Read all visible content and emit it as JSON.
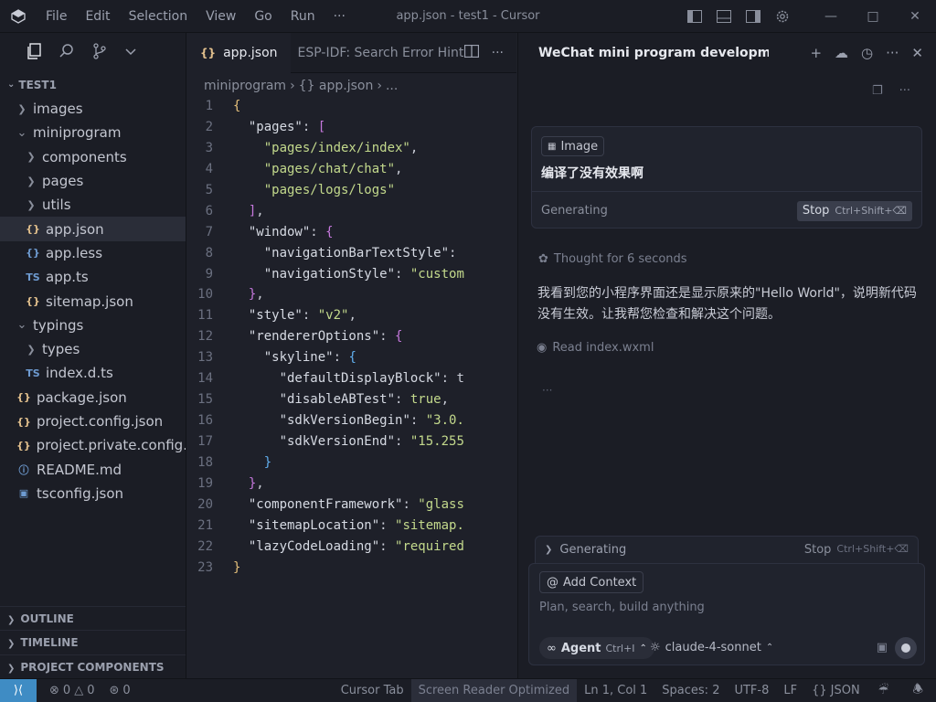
{
  "titlebar": {
    "menu": [
      "File",
      "Edit",
      "Selection",
      "View",
      "Go",
      "Run"
    ],
    "more": "···",
    "title": "app.json - test1 - Cursor"
  },
  "explorer": {
    "root": "TEST1",
    "items": [
      {
        "label": "images",
        "type": "folder",
        "open": false,
        "depth": 1
      },
      {
        "label": "miniprogram",
        "type": "folder",
        "open": true,
        "depth": 1
      },
      {
        "label": "components",
        "type": "folder",
        "open": false,
        "depth": 2
      },
      {
        "label": "pages",
        "type": "folder",
        "open": false,
        "depth": 2
      },
      {
        "label": "utils",
        "type": "folder",
        "open": false,
        "depth": 2
      },
      {
        "label": "app.json",
        "type": "json",
        "depth": 2,
        "active": true
      },
      {
        "label": "app.less",
        "type": "less",
        "depth": 2
      },
      {
        "label": "app.ts",
        "type": "ts",
        "depth": 2
      },
      {
        "label": "sitemap.json",
        "type": "json",
        "depth": 2
      },
      {
        "label": "typings",
        "type": "folder",
        "open": true,
        "depth": 1
      },
      {
        "label": "types",
        "type": "folder",
        "open": false,
        "depth": 2
      },
      {
        "label": "index.d.ts",
        "type": "ts",
        "depth": 2
      },
      {
        "label": "package.json",
        "type": "json",
        "depth": 1
      },
      {
        "label": "project.config.json",
        "type": "json",
        "depth": 1
      },
      {
        "label": "project.private.config....",
        "type": "json",
        "depth": 1
      },
      {
        "label": "README.md",
        "type": "info",
        "depth": 1
      },
      {
        "label": "tsconfig.json",
        "type": "tsconf",
        "depth": 1
      }
    ],
    "bottom": [
      "OUTLINE",
      "TIMELINE",
      "PROJECT COMPONENTS"
    ]
  },
  "editor": {
    "tabs": [
      {
        "label": "app.json",
        "active": true
      },
      {
        "label": "ESP-IDF: Search Error Hint",
        "active": false
      }
    ],
    "breadcrumb": [
      "miniprogram",
      "{} app.json",
      "..."
    ],
    "lines": [
      "{",
      "  \"pages\": [",
      "    \"pages/index/index\",",
      "    \"pages/chat/chat\",",
      "    \"pages/logs/logs\"",
      "  ],",
      "  \"window\": {",
      "    \"navigationBarTextStyle\":",
      "    \"navigationStyle\": \"custom",
      "  },",
      "  \"style\": \"v2\",",
      "  \"rendererOptions\": {",
      "    \"skyline\": {",
      "      \"defaultDisplayBlock\": t",
      "      \"disableABTest\": true,",
      "      \"sdkVersionBegin\": \"3.0.",
      "      \"sdkVersionEnd\": \"15.255",
      "    }",
      "  },",
      "  \"componentFramework\": \"glass",
      "  \"sitemapLocation\": \"sitemap.",
      "  \"lazyCodeLoading\": \"required",
      "}"
    ]
  },
  "chat": {
    "title": "WeChat mini program development r",
    "user_message": {
      "tag": "Image",
      "text": "编译了没有效果啊",
      "status": "Generating",
      "stop_label": "Stop",
      "stop_shortcut": "Ctrl+Shift+⌫"
    },
    "thought": "Thought for 6 seconds",
    "reply": "我看到您的小程序界面还是显示原来的\"Hello World\"，说明新代码没有生效。让我帮您检查和解决这个问题。",
    "read_file": "Read index.wxml",
    "dots": "···",
    "generating_bar": {
      "label": "Generating",
      "stop_label": "Stop",
      "stop_shortcut": "Ctrl+Shift+⌫"
    },
    "input": {
      "add_context": "Add Context",
      "placeholder": "Plan, search, build anything",
      "agent_label": "Agent",
      "agent_shortcut": "Ctrl+I",
      "model": "claude-4-sonnet"
    }
  },
  "status": {
    "errors": "0",
    "warnings": "0",
    "ports": "0",
    "cursor_tab": "Cursor Tab",
    "screen_reader": "Screen Reader Optimized",
    "position": "Ln 1, Col 1",
    "spaces": "Spaces: 2",
    "encoding": "UTF-8",
    "eol": "LF",
    "language": "JSON"
  },
  "colors": {
    "accent": "#3f8cc4",
    "json_icon": "#e2c08d",
    "string": "#c3d98c"
  }
}
